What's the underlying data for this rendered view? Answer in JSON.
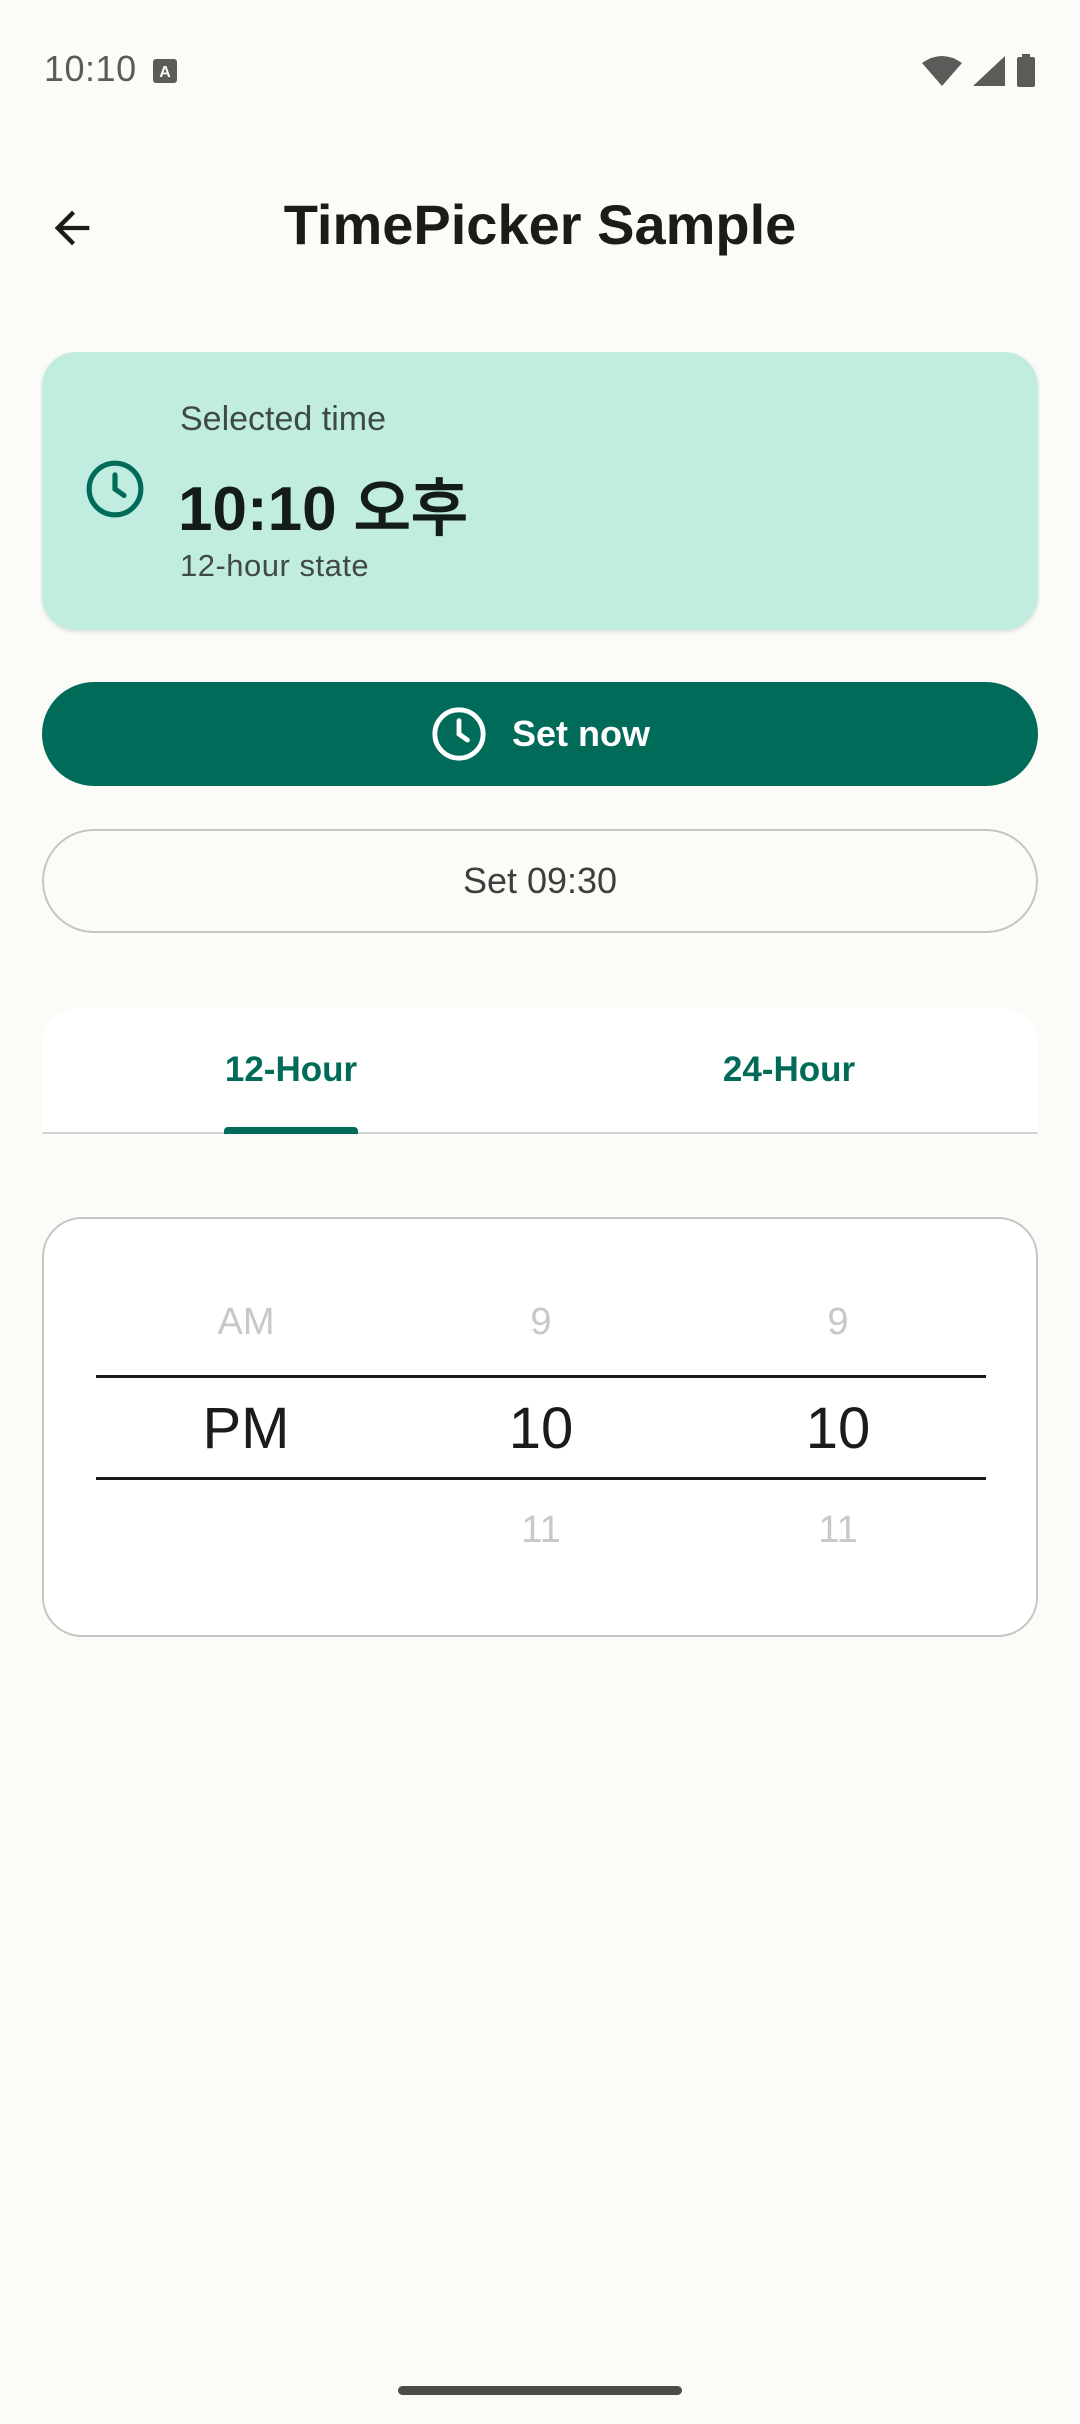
{
  "status_bar": {
    "time": "10:10",
    "icons": [
      "keyboard-a-icon",
      "wifi-icon",
      "cell-signal-icon",
      "battery-icon"
    ]
  },
  "top_bar": {
    "title": "TimePicker Sample",
    "back_icon": "arrow-back-icon"
  },
  "selected_card": {
    "label": "Selected time",
    "time": "10:10 오후",
    "mode": "12-hour state",
    "icon": "clock-icon",
    "background": "#c1ede1"
  },
  "buttons": {
    "set_now": "Set now",
    "set_preset": "Set 09:30"
  },
  "tabs": {
    "items": [
      "12-Hour",
      "24-Hour"
    ],
    "selected": "12-Hour",
    "accent": "#006b58"
  },
  "picker": {
    "ampm": {
      "prev": "AM",
      "selected": "PM",
      "next": ""
    },
    "hour": {
      "prev": "9",
      "selected": "10",
      "next": "11"
    },
    "minute": {
      "prev": "9",
      "selected": "10",
      "next": "11"
    }
  }
}
